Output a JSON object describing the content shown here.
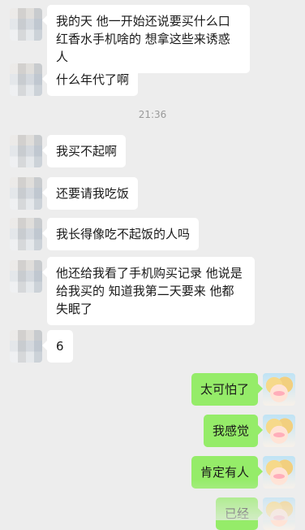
{
  "chat": {
    "timestamp": "21:36",
    "messages": [
      {
        "side": "in",
        "text": "我的天 他一开始还说要买什么口红香水手机啥的 想拿这些来诱惑人"
      },
      {
        "side": "in",
        "text": "什么年代了啊"
      },
      {
        "side": "in",
        "text": "我买不起啊"
      },
      {
        "side": "in",
        "text": "还要请我吃饭"
      },
      {
        "side": "in",
        "text": "我长得像吃不起饭的人吗"
      },
      {
        "side": "in",
        "text": "他还给我看了手机购买记录 他说是给我买的 知道我第二天要来 他都失眠了"
      },
      {
        "side": "in",
        "text": "6"
      },
      {
        "side": "out",
        "text": "太可怕了"
      },
      {
        "side": "out",
        "text": "我感觉"
      },
      {
        "side": "out",
        "text": "肯定有人"
      },
      {
        "side": "out",
        "text": "已经"
      }
    ]
  },
  "colors": {
    "background": "#ededed",
    "incoming_bubble": "#ffffff",
    "outgoing_bubble": "#95ec69",
    "timestamp_text": "#9a9a9a"
  },
  "icons": {
    "contact_avatar": "blurred-avatar",
    "self_avatar": "anime-girl-avatar"
  }
}
